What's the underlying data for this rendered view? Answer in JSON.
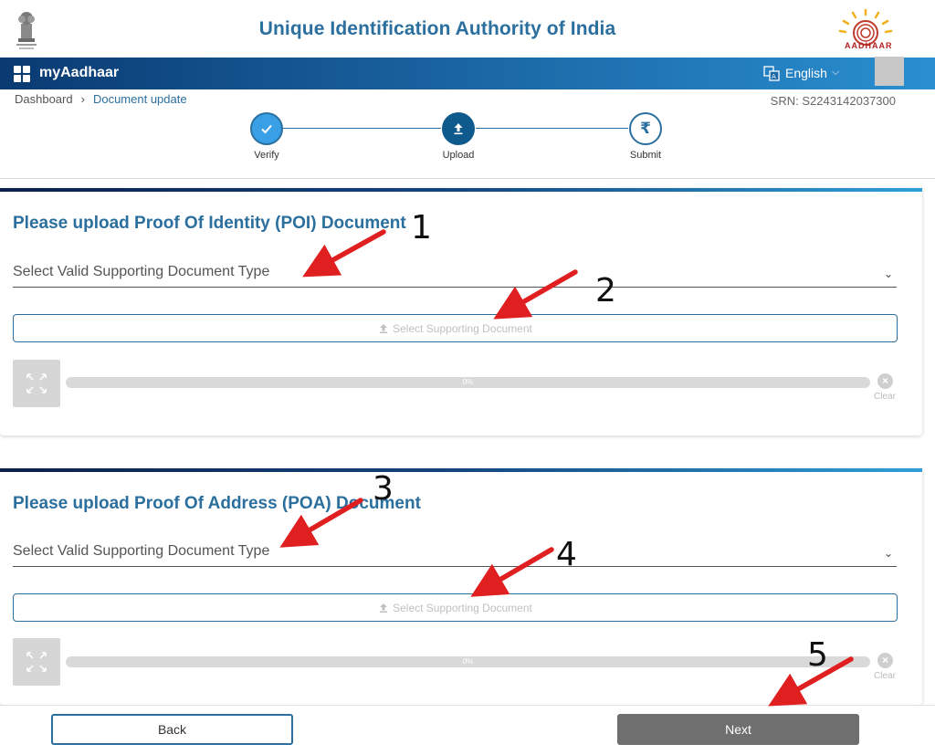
{
  "header": {
    "title": "Unique Identification Authority of India",
    "emblem_icon": "national-emblem-icon",
    "logo_text": "AADHAAR"
  },
  "nav": {
    "app_name": "myAadhaar",
    "language": "English"
  },
  "breadcrumb": {
    "items": [
      "Dashboard",
      "Document update"
    ]
  },
  "srn": "SRN: S2243142037300",
  "stepper": {
    "steps": [
      {
        "label": "Verify",
        "state": "done",
        "icon": "check-icon"
      },
      {
        "label": "Upload",
        "state": "active",
        "icon": "upload-icon"
      },
      {
        "label": "Submit",
        "state": "pending",
        "icon": "rupee-icon"
      }
    ]
  },
  "poi": {
    "title": "Please upload Proof Of Identity (POI) Document",
    "select_label": "Select Valid Supporting Document Type",
    "upload_label": "Select Supporting Document",
    "progress_text": "0%",
    "progress": 0,
    "clear_label": "Clear"
  },
  "poa": {
    "title": "Please upload Proof Of Address (POA) Document",
    "select_label": "Select Valid Supporting Document Type",
    "upload_label": "Select Supporting Document",
    "progress_text": "0%",
    "progress": 0,
    "clear_label": "Clear"
  },
  "footer": {
    "back_label": "Back",
    "next_label": "Next"
  },
  "annotations": [
    "1",
    "2",
    "3",
    "4",
    "5"
  ],
  "colors": {
    "primary": "#2b6f9e",
    "arrow": "#e02020",
    "next_button": "#6f6f6f"
  }
}
